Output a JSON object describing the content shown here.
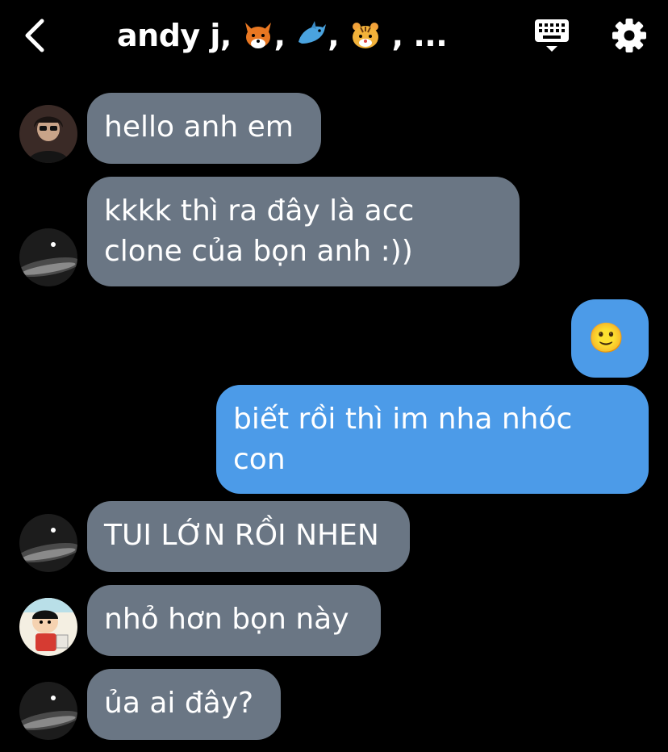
{
  "header": {
    "title_text": "andy j, ",
    "sep1": ", ",
    "sep2": ", ",
    "sep3": " ,  ",
    "ellipsis": "..."
  },
  "colors": {
    "background": "#000000",
    "incoming_bubble": "#6a7684",
    "outgoing_bubble": "#4c9be8"
  },
  "messages": [
    {
      "text": "hello anh em"
    },
    {
      "text": "kkkk thì ra đây là acc\nclone của bọn anh :))"
    },
    {
      "text": "🙂"
    },
    {
      "text": "biết rồi thì im nha nhóc\ncon"
    },
    {
      "text": "TUI LỚN RỒI NHEN"
    },
    {
      "text": "nhỏ hơn bọn này"
    },
    {
      "text": "ủa ai đây?"
    }
  ]
}
